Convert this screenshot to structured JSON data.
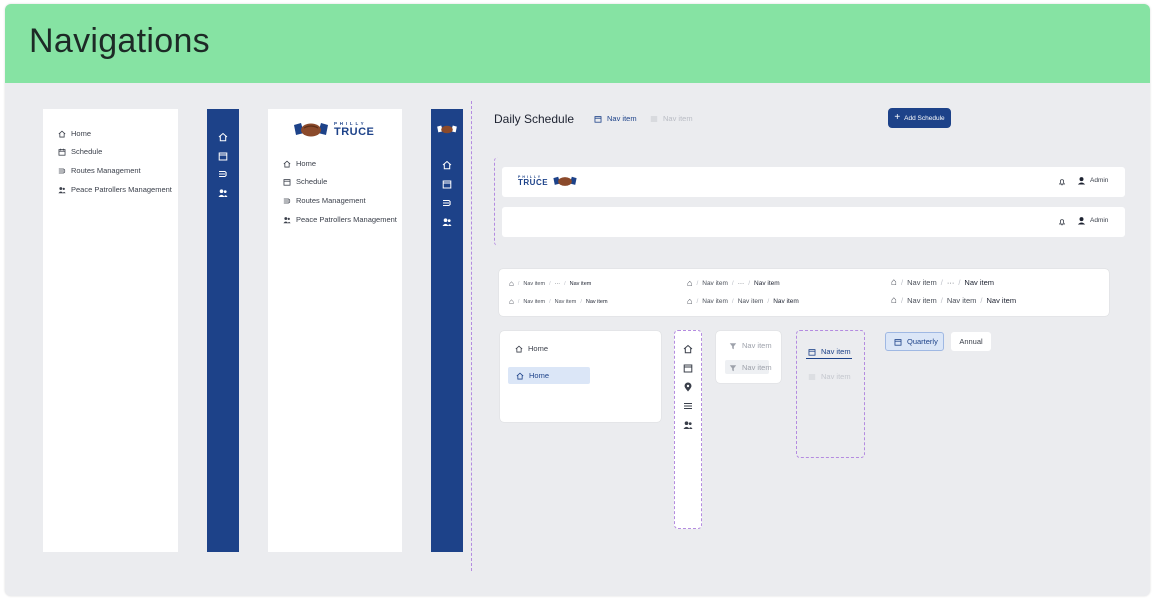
{
  "page": {
    "title": "Navigations"
  },
  "colors": {
    "header": "#86e3a3",
    "brand_blue": "#1d4289",
    "background": "#ebecef"
  },
  "sidebar_expanded": {
    "items": [
      {
        "label": "Home",
        "icon": "home-icon"
      },
      {
        "label": "Schedule",
        "icon": "calendar-icon"
      },
      {
        "label": "Routes Management",
        "icon": "routes-icon"
      },
      {
        "label": "Peace Patrollers Management",
        "icon": "users-icon"
      }
    ]
  },
  "logo": {
    "small": "PHILLY",
    "big": "TRUCE"
  },
  "sidebar_logo": {
    "items": [
      {
        "label": "Home",
        "icon": "home-icon"
      },
      {
        "label": "Schedule",
        "icon": "calendar-icon"
      },
      {
        "label": "Routes Management",
        "icon": "routes-icon"
      },
      {
        "label": "Peace Patrollers Management",
        "icon": "users-icon"
      }
    ]
  },
  "schedule_header": {
    "title": "Daily Schedule",
    "tab_active": "Nav item",
    "tab_inactive": "Nav item",
    "add_button": "Add Schedule"
  },
  "topbars": [
    {
      "user": "Admin",
      "has_logo": true
    },
    {
      "user": "Admin",
      "has_logo": false
    }
  ],
  "breadcrumbs": {
    "small": [
      [
        "Nav item",
        "···",
        "Nav item"
      ],
      [
        "Nav item",
        "Nav item",
        "Nav item"
      ]
    ],
    "medium": [
      [
        "Nav item",
        "···",
        "Nav item"
      ],
      [
        "Nav item",
        "Nav item",
        "Nav item"
      ]
    ],
    "large": [
      [
        "Nav item",
        "···",
        "Nav item"
      ],
      [
        "Nav item",
        "Nav item",
        "Nav item"
      ]
    ]
  },
  "home_card": {
    "item_default": "Home",
    "item_selected": "Home"
  },
  "filter_card": {
    "item1": "Nav item",
    "item2": "Nav item"
  },
  "tabs_vertical": {
    "active": "Nav item",
    "inactive": "Nav item"
  },
  "segmented": {
    "active": "Quarterly",
    "inactive": "Annual"
  }
}
